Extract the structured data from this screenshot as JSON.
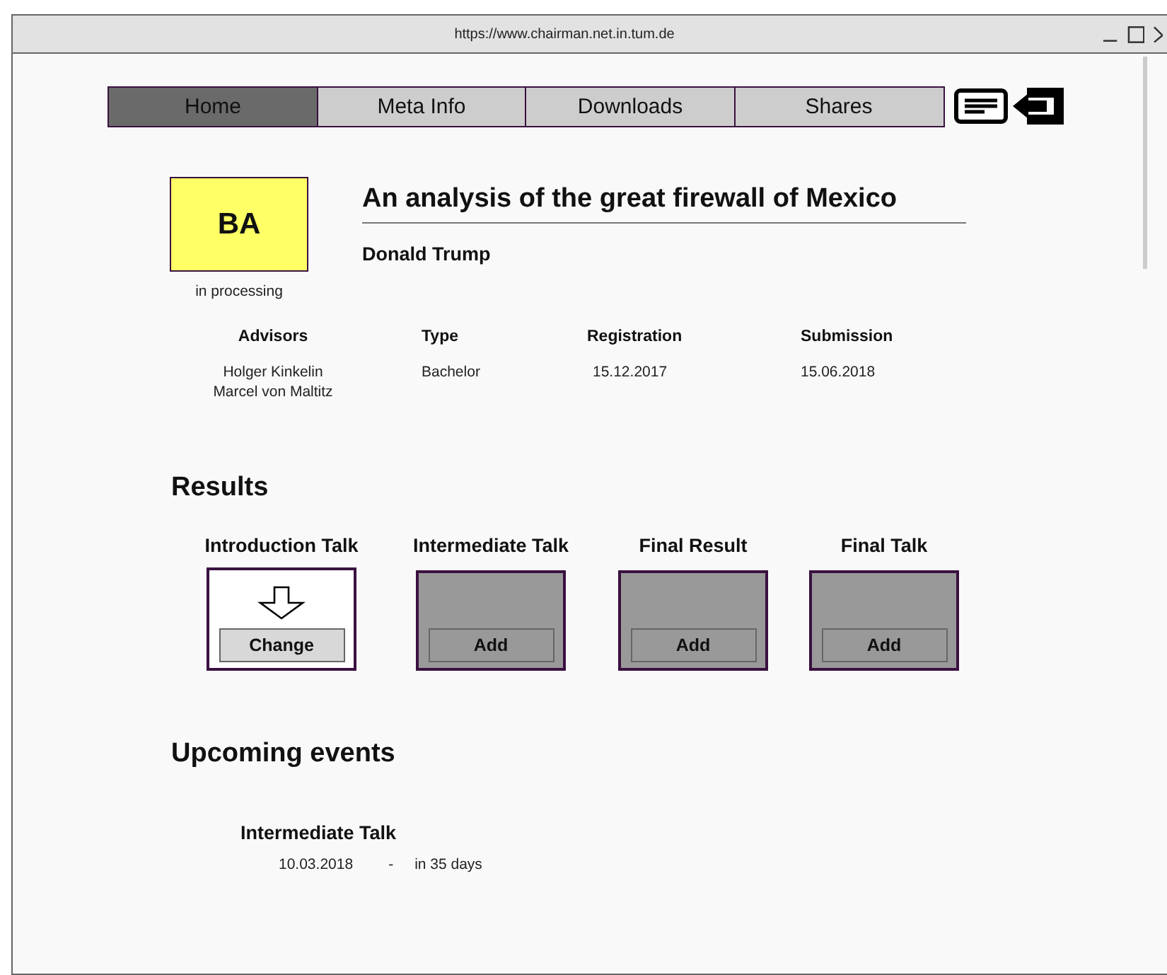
{
  "window": {
    "title": "https://www.chairman.net.in.tum.de"
  },
  "nav": [
    {
      "label": "Home",
      "selected": true
    },
    {
      "label": "Meta Info",
      "selected": false
    },
    {
      "label": "Downloads",
      "selected": false
    },
    {
      "label": "Shares",
      "selected": false
    }
  ],
  "thesis": {
    "badge": "BA",
    "status": "in processing",
    "title": "An analysis of the great firewall of Mexico",
    "author": "Donald Trump",
    "details": [
      {
        "label": "Advisors",
        "values": [
          "Holger Kinkelin",
          "Marcel von Maltitz"
        ]
      },
      {
        "label": "Type",
        "values": [
          "Bachelor"
        ]
      },
      {
        "label": "Registration",
        "values": [
          "15.12.2017"
        ]
      },
      {
        "label": "Submission",
        "values": [
          "15.06.2018"
        ]
      }
    ]
  },
  "results": {
    "heading": "Results",
    "items": [
      {
        "title": "Introduction Talk",
        "kind": "uploaded",
        "button": "Change"
      },
      {
        "title": "Intermediate Talk",
        "kind": "empty",
        "button": "Add"
      },
      {
        "title": "Final Result",
        "kind": "empty",
        "button": "Add"
      },
      {
        "title": "Final Talk",
        "kind": "empty",
        "button": "Add"
      }
    ]
  },
  "upcoming": {
    "heading": "Upcoming events",
    "events": [
      {
        "title": "Intermediate Talk",
        "date": "10.03.2018",
        "separator": "-",
        "remaining": "in 35 days"
      }
    ]
  }
}
